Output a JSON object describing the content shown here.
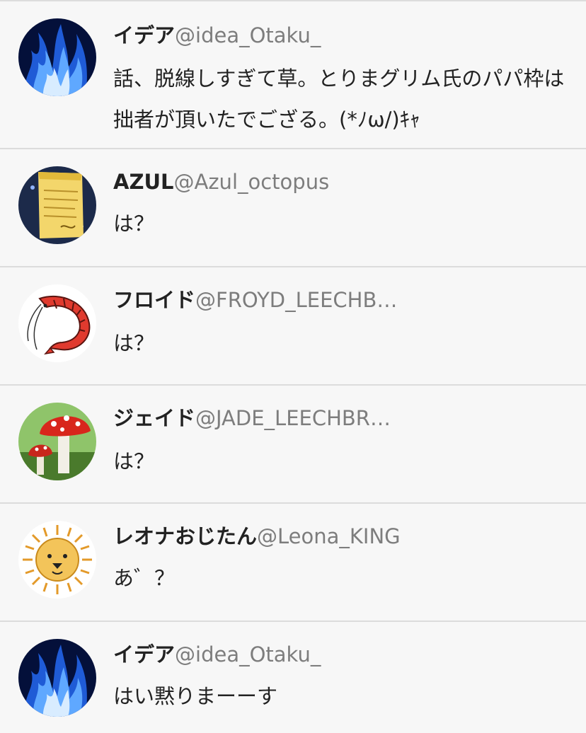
{
  "tweets": [
    {
      "name": "イデア",
      "handle": "@idea_Otaku_",
      "text": "話、脱線しすぎて草。とりまグリム氏のパパ枠は拙者が頂いたでござる。(*ﾉω/)ｷｬ",
      "avatar": "blue-flame-icon"
    },
    {
      "name": "AZUL",
      "handle": "@Azul_octopus",
      "text": "は？",
      "avatar": "contract-scroll-icon"
    },
    {
      "name": "フロイド",
      "handle": "@FROYD_LEECHB…",
      "text": "は？",
      "avatar": "shrimp-icon"
    },
    {
      "name": "ジェイド",
      "handle": "@JADE_LEECHBR…",
      "text": "は？",
      "avatar": "mushroom-icon"
    },
    {
      "name": "レオナおじたん",
      "handle": "@Leona_KING",
      "text": "あ゛？",
      "avatar": "lion-icon"
    },
    {
      "name": "イデア",
      "handle": "@idea_Otaku_",
      "text": "はい黙りまーーす",
      "avatar": "blue-flame-icon"
    }
  ]
}
